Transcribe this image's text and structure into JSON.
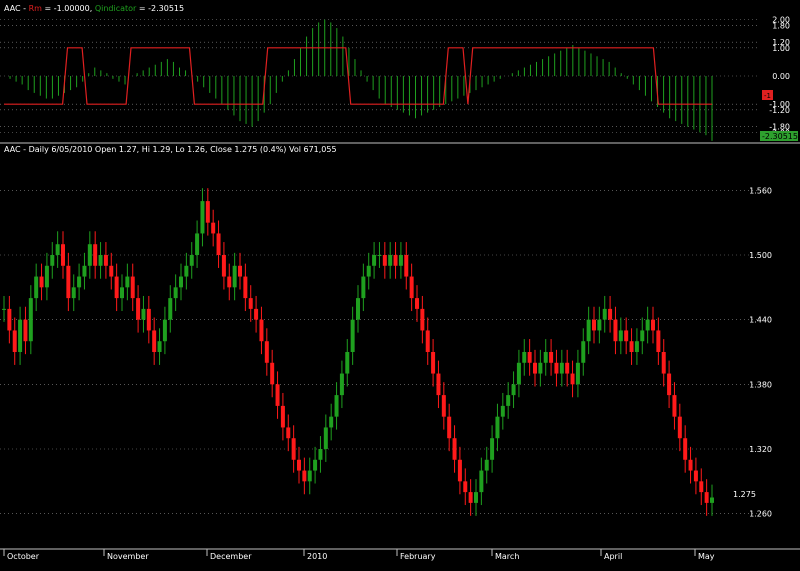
{
  "colors": {
    "background": "#000000",
    "rm_line": "#e02020",
    "qindicator": "#1fa01f",
    "candle_up": "#1fa01f",
    "candle_down": "#ff1a1a",
    "grid": "#8a8a8a",
    "frame": "#bfbfbf"
  },
  "indicator_panel": {
    "symbol": "AAC",
    "sep1": " - ",
    "rm_label": "Rm",
    "rm_value": "= -1.00000,",
    "q_label": "Qindicator",
    "q_value": "= -2.30515",
    "axis_ticks": [
      "2.00",
      "1.80",
      "1.20",
      "1.00",
      "0.00",
      "-1.00",
      "-1.20",
      "-1.80",
      "-2.00"
    ],
    "rm_badge": "-1",
    "q_badge": "-2.30515"
  },
  "price_panel": {
    "header": "AAC - Daily 6/05/2010 Open 1.27, Hi 1.29, Lo 1.26, Close 1.275 (0.4%) Vol 671,055",
    "axis_ticks": [
      "1.560",
      "1.500",
      "1.440",
      "1.380",
      "1.320",
      "1.260"
    ],
    "last_price": "1.275"
  },
  "x_axis": {
    "months": [
      "October",
      "November",
      "December",
      "2010",
      "February",
      "March",
      "April",
      "May"
    ]
  },
  "chart_data": [
    {
      "type": "line",
      "title": "AAC - Rm = -1.00000, Qindicator = -2.30515",
      "ylim": [
        -2.2,
        2.2
      ],
      "series": [
        {
          "name": "Rm",
          "values": [
            -1,
            -1,
            -1,
            -1,
            -1,
            -1,
            -1,
            -1,
            -1,
            -1,
            -1,
            -1,
            -1,
            1,
            1,
            1,
            1,
            -1,
            -1,
            -1,
            -1,
            -1,
            -1,
            -1,
            -1,
            -1,
            1,
            1,
            1,
            1,
            1,
            1,
            1,
            1,
            1,
            1,
            1,
            1,
            1,
            -1,
            -1,
            -1,
            -1,
            -1,
            -1,
            -1,
            -1,
            -1,
            -1,
            -1,
            -1,
            -1,
            -1,
            -1,
            1,
            1,
            1,
            1,
            1,
            1,
            1,
            1,
            1,
            1,
            1,
            1,
            1,
            1,
            1,
            1,
            1,
            -1,
            -1,
            -1,
            -1,
            -1,
            -1,
            -1,
            -1,
            -1,
            -1,
            -1,
            -1,
            -1,
            -1,
            -1,
            -1,
            -1,
            -1,
            -1,
            -1,
            1,
            1,
            1,
            1,
            -1,
            1,
            1,
            1,
            1,
            1,
            1,
            1,
            1,
            1,
            1,
            1,
            1,
            1,
            1,
            1,
            1,
            1,
            1,
            1,
            1,
            1,
            1,
            1,
            1,
            1,
            1,
            1,
            1,
            1,
            1,
            1,
            1,
            1,
            1,
            1,
            1,
            1,
            1,
            -1,
            -1,
            -1,
            -1,
            -1,
            -1,
            -1,
            -1,
            -1,
            -1,
            -1,
            -1
          ]
        },
        {
          "name": "Qindicator",
          "values": [
            0.0,
            -0.1,
            -0.2,
            -0.3,
            -0.5,
            -0.6,
            -0.7,
            -0.8,
            -0.8,
            -0.7,
            -0.6,
            -0.5,
            -0.4,
            -0.2,
            0.1,
            0.3,
            0.2,
            0.1,
            -0.1,
            -0.2,
            -0.3,
            0.0,
            0.1,
            0.2,
            0.3,
            0.4,
            0.5,
            0.6,
            0.5,
            0.3,
            0.2,
            0.0,
            -0.2,
            -0.4,
            -0.6,
            -0.8,
            -1.0,
            -1.2,
            -1.4,
            -1.6,
            -1.7,
            -1.8,
            -1.6,
            -1.3,
            -1.0,
            -0.6,
            -0.2,
            0.2,
            0.6,
            1.0,
            1.4,
            1.7,
            1.9,
            2.0,
            1.9,
            1.7,
            1.4,
            1.0,
            0.6,
            0.2,
            -0.2,
            -0.5,
            -0.8,
            -1.0,
            -1.1,
            -1.2,
            -1.3,
            -1.4,
            -1.5,
            -1.4,
            -1.3,
            -1.2,
            -1.1,
            -1.0,
            -0.9,
            -0.8,
            -0.7,
            -0.6,
            -0.5,
            -0.4,
            -0.3,
            -0.2,
            -0.1,
            0.0,
            0.1,
            0.2,
            0.3,
            0.4,
            0.5,
            0.6,
            0.7,
            0.8,
            0.9,
            1.0,
            1.1,
            1.0,
            0.9,
            0.8,
            0.7,
            0.6,
            0.5,
            0.3,
            0.1,
            -0.1,
            -0.3,
            -0.5,
            -0.7,
            -0.9,
            -1.1,
            -1.3,
            -1.5,
            -1.6,
            -1.7,
            -1.8,
            -1.9,
            -2.0,
            -2.1,
            -2.3
          ]
        }
      ]
    },
    {
      "type": "candlestick",
      "title": "AAC - Daily 6/05/2010 Open 1.27, Hi 1.29, Lo 1.26, Close 1.275 (0.4%) Vol 671,055",
      "ylim": [
        1.23,
        1.59
      ],
      "x": [
        "October",
        "November",
        "December",
        "2010",
        "February",
        "March",
        "April",
        "May"
      ],
      "close": [
        1.45,
        1.43,
        1.41,
        1.44,
        1.42,
        1.46,
        1.48,
        1.47,
        1.49,
        1.5,
        1.51,
        1.49,
        1.46,
        1.47,
        1.48,
        1.49,
        1.51,
        1.49,
        1.5,
        1.49,
        1.48,
        1.46,
        1.47,
        1.48,
        1.46,
        1.44,
        1.45,
        1.43,
        1.41,
        1.42,
        1.44,
        1.46,
        1.47,
        1.48,
        1.49,
        1.5,
        1.52,
        1.55,
        1.53,
        1.52,
        1.5,
        1.48,
        1.47,
        1.49,
        1.48,
        1.46,
        1.45,
        1.44,
        1.42,
        1.4,
        1.38,
        1.36,
        1.34,
        1.33,
        1.31,
        1.3,
        1.29,
        1.3,
        1.31,
        1.32,
        1.34,
        1.35,
        1.37,
        1.39,
        1.41,
        1.44,
        1.46,
        1.48,
        1.49,
        1.5,
        1.5,
        1.49,
        1.5,
        1.49,
        1.5,
        1.48,
        1.46,
        1.45,
        1.43,
        1.41,
        1.39,
        1.37,
        1.35,
        1.33,
        1.31,
        1.29,
        1.28,
        1.27,
        1.28,
        1.3,
        1.31,
        1.33,
        1.35,
        1.36,
        1.37,
        1.38,
        1.4,
        1.41,
        1.4,
        1.39,
        1.4,
        1.41,
        1.4,
        1.39,
        1.4,
        1.39,
        1.38,
        1.4,
        1.42,
        1.44,
        1.43,
        1.44,
        1.45,
        1.44,
        1.42,
        1.43,
        1.42,
        1.41,
        1.42,
        1.43,
        1.44,
        1.43,
        1.41,
        1.39,
        1.37,
        1.35,
        1.33,
        1.31,
        1.3,
        1.29,
        1.28,
        1.27,
        1.275
      ]
    }
  ]
}
